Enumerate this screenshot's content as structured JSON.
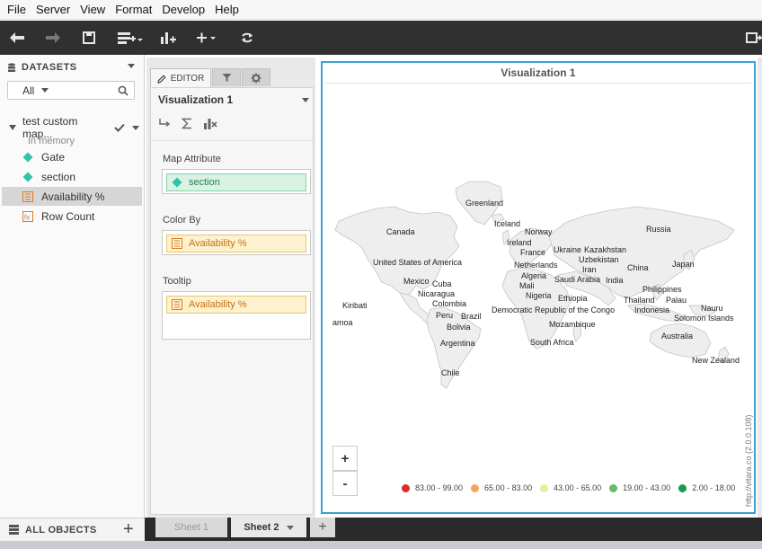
{
  "menu": [
    "File",
    "Server",
    "View",
    "Format",
    "Develop",
    "Help"
  ],
  "toolbar": {
    "icons": [
      "undo-icon",
      "redo-icon",
      "save-icon",
      "add-data-icon",
      "add-visualization-icon",
      "add-icon",
      "refresh-icon",
      "panel-icon"
    ]
  },
  "datasets": {
    "header": "DATASETS",
    "filter_value": "All",
    "dataset_name": "test custom map...",
    "dataset_status": "In memory",
    "items": [
      {
        "label": "Gate",
        "type": "attribute"
      },
      {
        "label": "section",
        "type": "attribute"
      },
      {
        "label": "Availability %",
        "type": "metric",
        "selected": true
      },
      {
        "label": "Row Count",
        "type": "derived-metric"
      }
    ]
  },
  "all_objects": "ALL OBJECTS",
  "editor": {
    "tab_label": "EDITOR",
    "visualization_name": "Visualization 1",
    "sections": [
      {
        "label": "Map Attribute",
        "chip": "section",
        "kind": "attr"
      },
      {
        "label": "Color By",
        "chip": "Availability %",
        "kind": "metric"
      },
      {
        "label": "Tooltip",
        "chip": "Availability %",
        "kind": "metric"
      }
    ]
  },
  "viz": {
    "title": "Visualization 1",
    "zoom_in": "+",
    "zoom_out": "-",
    "credit": "http://vitara.co  (2.0.0.108)",
    "countries": [
      "Greenland",
      "Iceland",
      "Norway",
      "Canada",
      "Ireland",
      "France",
      "Russia",
      "Ukraine",
      "Kazakhstan",
      "Uzbekistan",
      "United States of America",
      "Netherlands",
      "Iran",
      "China",
      "Japan",
      "Algeria",
      "Saudi Arabia",
      "India",
      "Mexico",
      "Cuba",
      "Mali",
      "Philippines",
      "Nicaragua",
      "Nigeria",
      "Ethiopia",
      "Thailand",
      "Palau",
      "Colombia",
      "Kiribati",
      "Democratic Republic of the Congo",
      "Indonesia",
      "Nauru",
      "Peru",
      "Brazil",
      "Solomon Islands",
      "amoa",
      "Bolivia",
      "Mozambique",
      "Australia",
      "Argentina",
      "South Africa",
      "New Zealand",
      "Chile"
    ],
    "legend": [
      {
        "label": "83.00 - 99.00",
        "color": "#d73027"
      },
      {
        "label": "65.00 - 83.00",
        "color": "#f4a460"
      },
      {
        "label": "43.00 - 65.00",
        "color": "#e6ee9c"
      },
      {
        "label": "19.00 - 43.00",
        "color": "#66bb6a"
      },
      {
        "label": "2.00 - 18.00",
        "color": "#1a9850"
      }
    ]
  },
  "sheets": {
    "tabs": [
      "Sheet 1",
      "Sheet 2"
    ],
    "active": "Sheet 2",
    "add": "+"
  }
}
